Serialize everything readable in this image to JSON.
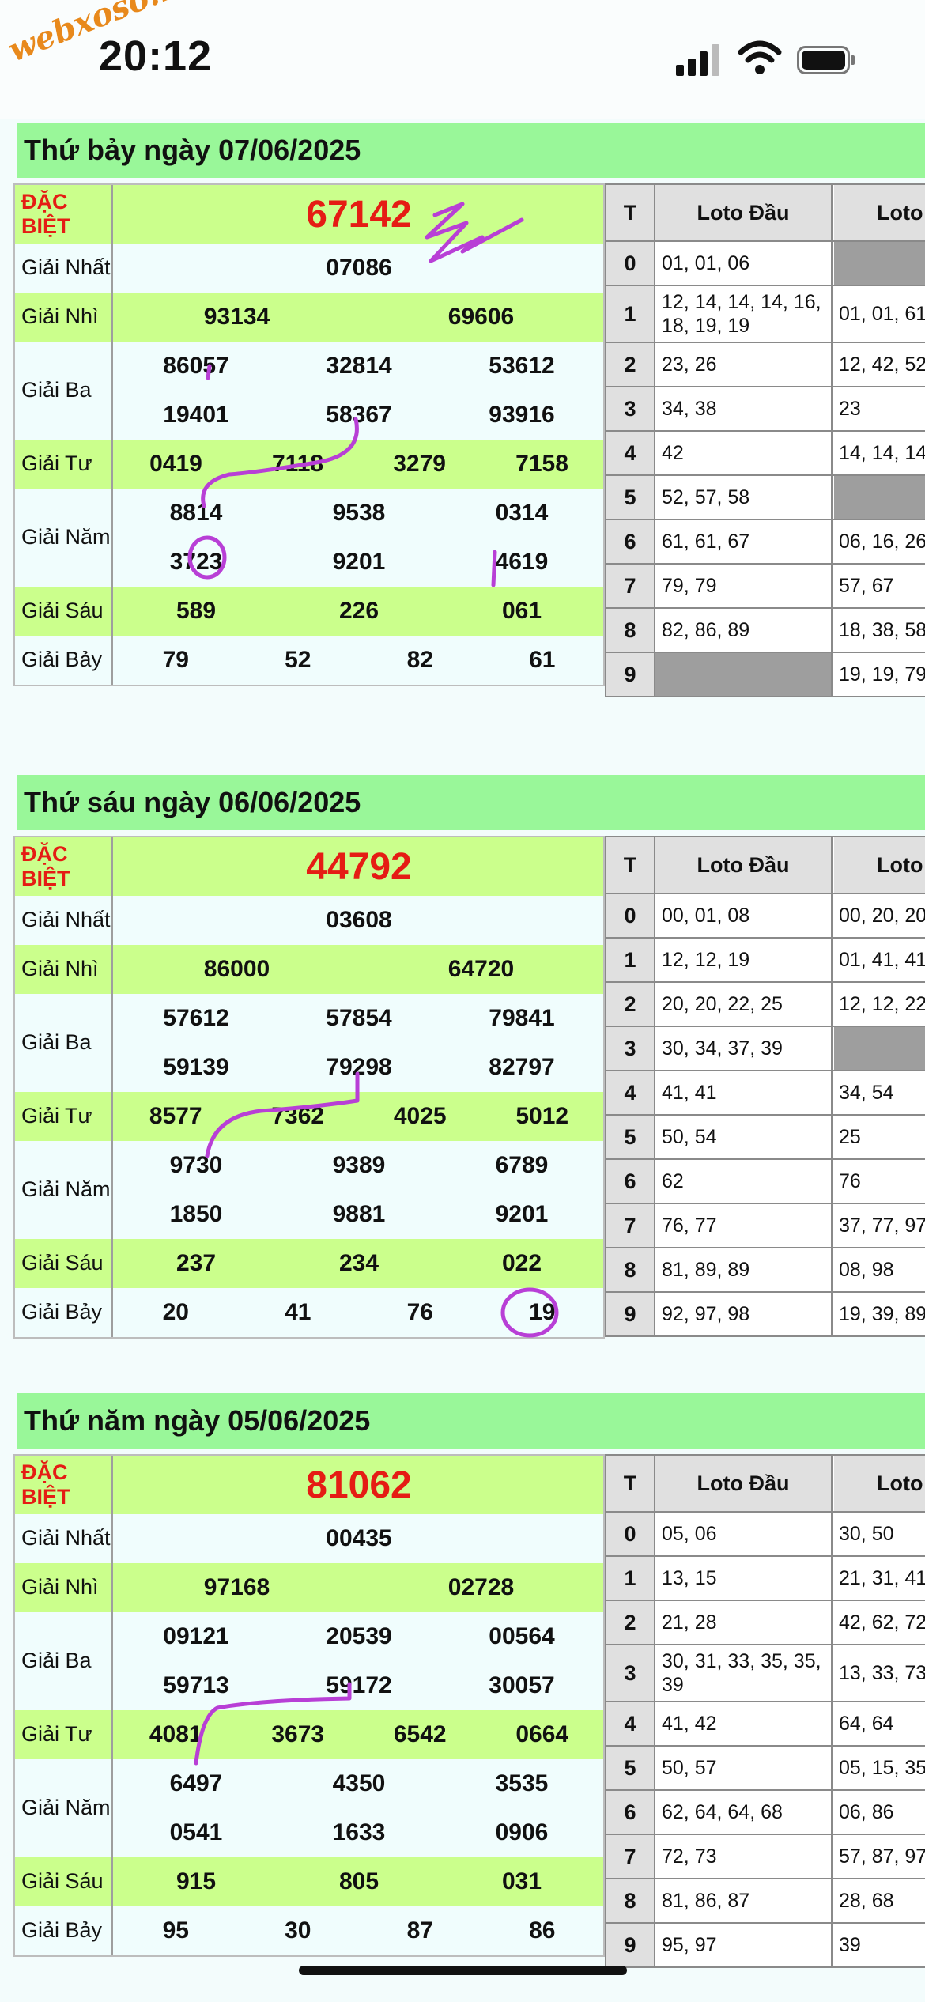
{
  "status": {
    "time": "20:12",
    "watermark": "webxoso.net"
  },
  "colors": {
    "header_green": "#99f799",
    "row_green": "#cbff8c",
    "special_red": "#e51c14",
    "annotation": "#b83fd6"
  },
  "labels": {
    "special": "ĐẶC BIỆT",
    "first": "Giải Nhất",
    "second": "Giải Nhì",
    "third": "Giải Ba",
    "fourth": "Giải Tư",
    "fifth": "Giải Năm",
    "sixth": "Giải Sáu",
    "seventh": "Giải Bảy",
    "loto_t": "T",
    "loto_dau": "Loto Đầu",
    "loto_duoi": "Loto"
  },
  "sections": [
    {
      "title": "Thứ bảy ngày 07/06/2025",
      "special": "67142",
      "first": "07086",
      "second": [
        "93134",
        "69606"
      ],
      "third": [
        "86057",
        "32814",
        "53612",
        "19401",
        "58367",
        "93916"
      ],
      "fourth": [
        "0419",
        "7118",
        "3279",
        "7158"
      ],
      "fifth": [
        "8814",
        "9538",
        "0314",
        "3723",
        "9201",
        "4619"
      ],
      "sixth": [
        "589",
        "226",
        "061"
      ],
      "seventh": [
        "79",
        "52",
        "82",
        "61"
      ],
      "loto": [
        {
          "t": "0",
          "dau": "01, 01, 06",
          "duoi": ""
        },
        {
          "t": "1",
          "dau": "12, 14, 14, 14, 16, 18, 19, 19",
          "duoi": "01, 01, 61"
        },
        {
          "t": "2",
          "dau": "23, 26",
          "duoi": "12, 42, 52"
        },
        {
          "t": "3",
          "dau": "34, 38",
          "duoi": "23"
        },
        {
          "t": "4",
          "dau": "42",
          "duoi": "14, 14, 14"
        },
        {
          "t": "5",
          "dau": "52, 57, 58",
          "duoi": ""
        },
        {
          "t": "6",
          "dau": "61, 61, 67",
          "duoi": "06, 16, 26"
        },
        {
          "t": "7",
          "dau": "79, 79",
          "duoi": "57, 67"
        },
        {
          "t": "8",
          "dau": "82, 86, 89",
          "duoi": "18, 38, 58"
        },
        {
          "t": "9",
          "dau": "",
          "duoi": "19, 19, 79"
        }
      ]
    },
    {
      "title": "Thứ sáu ngày 06/06/2025",
      "special": "44792",
      "first": "03608",
      "second": [
        "86000",
        "64720"
      ],
      "third": [
        "57612",
        "57854",
        "79841",
        "59139",
        "79298",
        "82797"
      ],
      "fourth": [
        "8577",
        "7362",
        "4025",
        "5012"
      ],
      "fifth": [
        "9730",
        "9389",
        "6789",
        "1850",
        "9881",
        "9201"
      ],
      "sixth": [
        "237",
        "234",
        "022"
      ],
      "seventh": [
        "20",
        "41",
        "76",
        "19"
      ],
      "loto": [
        {
          "t": "0",
          "dau": "00, 01, 08",
          "duoi": "00, 20, 20"
        },
        {
          "t": "1",
          "dau": "12, 12, 19",
          "duoi": "01, 41, 41"
        },
        {
          "t": "2",
          "dau": "20, 20, 22, 25",
          "duoi": "12, 12, 22"
        },
        {
          "t": "3",
          "dau": "30, 34, 37, 39",
          "duoi": ""
        },
        {
          "t": "4",
          "dau": "41, 41",
          "duoi": "34, 54"
        },
        {
          "t": "5",
          "dau": "50, 54",
          "duoi": "25"
        },
        {
          "t": "6",
          "dau": "62",
          "duoi": "76"
        },
        {
          "t": "7",
          "dau": "76, 77",
          "duoi": "37, 77, 97"
        },
        {
          "t": "8",
          "dau": "81, 89, 89",
          "duoi": "08, 98"
        },
        {
          "t": "9",
          "dau": "92, 97, 98",
          "duoi": "19, 39, 89"
        }
      ]
    },
    {
      "title": "Thứ năm ngày 05/06/2025",
      "special": "81062",
      "first": "00435",
      "second": [
        "97168",
        "02728"
      ],
      "third": [
        "09121",
        "20539",
        "00564",
        "59713",
        "59172",
        "30057"
      ],
      "fourth": [
        "4081",
        "3673",
        "6542",
        "0664"
      ],
      "fifth": [
        "6497",
        "4350",
        "3535",
        "0541",
        "1633",
        "0906"
      ],
      "sixth": [
        "915",
        "805",
        "031"
      ],
      "seventh": [
        "95",
        "30",
        "87",
        "86"
      ],
      "loto": [
        {
          "t": "0",
          "dau": "05, 06",
          "duoi": "30, 50"
        },
        {
          "t": "1",
          "dau": "13, 15",
          "duoi": "21, 31, 41"
        },
        {
          "t": "2",
          "dau": "21, 28",
          "duoi": "42, 62, 72"
        },
        {
          "t": "3",
          "dau": "30, 31, 33, 35, 35, 39",
          "duoi": "13, 33, 73"
        },
        {
          "t": "4",
          "dau": "41, 42",
          "duoi": "64, 64"
        },
        {
          "t": "5",
          "dau": "50, 57",
          "duoi": "05, 15, 35"
        },
        {
          "t": "6",
          "dau": "62, 64, 64, 68",
          "duoi": "06, 86"
        },
        {
          "t": "7",
          "dau": "72, 73",
          "duoi": "57, 87, 97"
        },
        {
          "t": "8",
          "dau": "81, 86, 87",
          "duoi": "28, 68"
        },
        {
          "t": "9",
          "dau": "95, 97",
          "duoi": "39"
        }
      ]
    }
  ]
}
